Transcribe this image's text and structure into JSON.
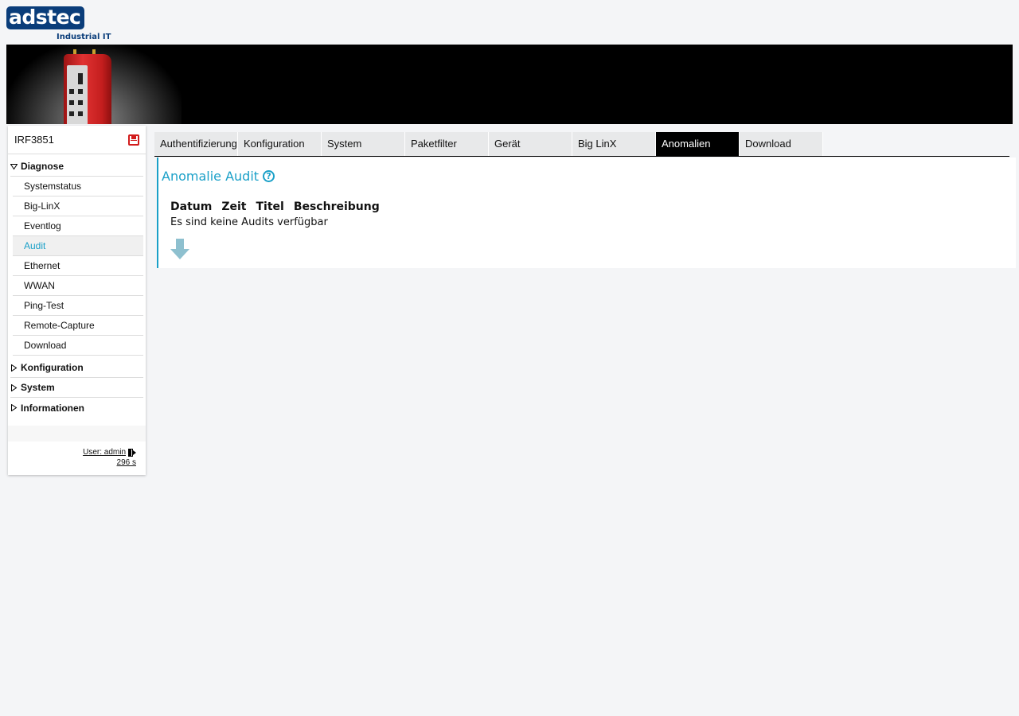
{
  "logo": {
    "brand": "adstec",
    "tagline": "Industrial IT"
  },
  "sidebar": {
    "device_name": "IRF3851",
    "sections": [
      {
        "label": "Diagnose",
        "expanded": true,
        "items": [
          "Systemstatus",
          "Big-LinX",
          "Eventlog",
          "Audit",
          "Ethernet",
          "WWAN",
          "Ping-Test",
          "Remote-Capture",
          "Download"
        ],
        "active_item": "Audit"
      },
      {
        "label": "Konfiguration",
        "expanded": false
      },
      {
        "label": "System",
        "expanded": false
      },
      {
        "label": "Informationen",
        "expanded": false
      }
    ],
    "user_label": "User: admin",
    "timer": "296 s"
  },
  "tabs": [
    "Authentifizierung",
    "Konfiguration",
    "System",
    "Paketfilter",
    "Gerät",
    "Big LinX",
    "Anomalien",
    "Download"
  ],
  "active_tab": "Anomalien",
  "content": {
    "title": "Anomalie Audit",
    "columns": [
      "Datum",
      "Zeit",
      "Titel",
      "Beschreibung"
    ],
    "empty_message": "Es sind keine Audits verfügbar"
  },
  "colors": {
    "accent": "#1aa0c8",
    "brand": "#0a3d7a",
    "save": "#d21c1c",
    "active_tab_bg": "#000000"
  }
}
